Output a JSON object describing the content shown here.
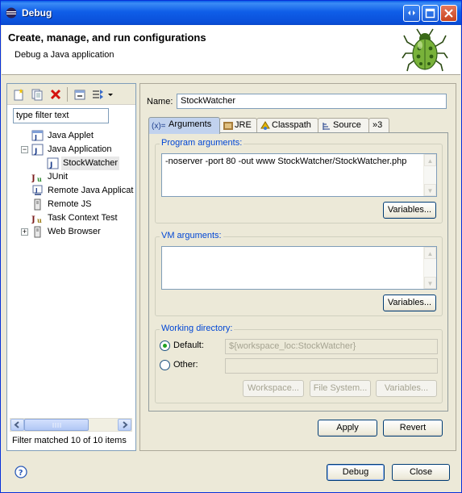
{
  "window": {
    "title": "Debug"
  },
  "header": {
    "title": "Create, manage, and run configurations",
    "subtitle": "Debug a Java application"
  },
  "left": {
    "filter_placeholder": "type filter text",
    "tree": [
      {
        "label": "Java Applet",
        "icon": "java-applet-icon"
      },
      {
        "label": "Java Application",
        "icon": "java-application-icon",
        "expanded": true
      },
      {
        "label": "StockWatcher",
        "icon": "java-class-icon",
        "selected": true
      },
      {
        "label": "JUnit",
        "icon": "junit-icon"
      },
      {
        "label": "Remote Java Applicat",
        "icon": "remote-java-icon"
      },
      {
        "label": "Remote JS",
        "icon": "remote-js-icon"
      },
      {
        "label": "Task Context Test",
        "icon": "task-context-icon"
      },
      {
        "label": "Web Browser",
        "icon": "web-browser-icon",
        "expandable": true
      }
    ],
    "status": "Filter matched 10 of 10 items"
  },
  "config": {
    "name_label": "Name:",
    "name_value": "StockWatcher",
    "tabs": [
      {
        "label": "Arguments",
        "icon": "(x)=",
        "active": true
      },
      {
        "label": "JRE",
        "icon": "jre-icon"
      },
      {
        "label": "Classpath",
        "icon": "classpath-icon"
      },
      {
        "label": "Source",
        "icon": "source-icon"
      },
      {
        "label": "»3",
        "icon": ""
      }
    ],
    "program_args": {
      "title": "Program arguments:",
      "value": "-noserver -port 80 -out www StockWatcher/StockWatcher.php",
      "variables": "Variables..."
    },
    "vm_args": {
      "title": "VM arguments:",
      "value": "",
      "variables": "Variables..."
    },
    "working_dir": {
      "title": "Working directory:",
      "default_label": "Default:",
      "default_value": "${workspace_loc:StockWatcher}",
      "other_label": "Other:",
      "other_value": "",
      "workspace_btn": "Workspace...",
      "filesystem_btn": "File System...",
      "variables_btn": "Variables..."
    },
    "apply": "Apply",
    "revert": "Revert"
  },
  "footer": {
    "debug": "Debug",
    "close": "Close"
  },
  "colors": {
    "titlebar": "#0a5ee7",
    "group_title": "#0046d5",
    "dialog_bg": "#ece9d8"
  }
}
